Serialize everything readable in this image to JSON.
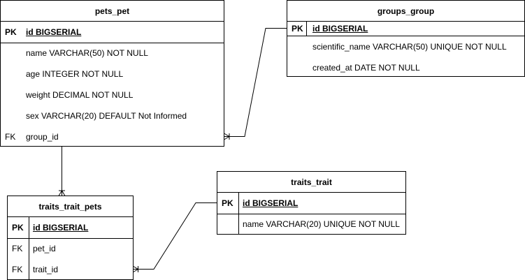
{
  "entities": {
    "pets_pet": {
      "title": "pets_pet",
      "rows": [
        {
          "key": "PK",
          "field": "id BIGSERIAL"
        },
        {
          "key": "",
          "field": "name VARCHAR(50) NOT NULL"
        },
        {
          "key": "",
          "field": "age INTEGER NOT NULL"
        },
        {
          "key": "",
          "field": "weight DECIMAL NOT NULL"
        },
        {
          "key": "",
          "field": "sex VARCHAR(20) DEFAULT Not Informed"
        },
        {
          "key": "FK",
          "field": "group_id"
        }
      ]
    },
    "groups_group": {
      "title": "groups_group",
      "rows": [
        {
          "key": "PK",
          "field": "id BIGSERIAL"
        },
        {
          "key": "",
          "field": "scientific_name VARCHAR(50) UNIQUE NOT NULL"
        },
        {
          "key": "",
          "field": "created_at DATE NOT NULL"
        }
      ]
    },
    "traits_trait_pets": {
      "title": "traits_trait_pets",
      "rows": [
        {
          "key": "PK",
          "field": "id BIGSERIAL"
        },
        {
          "key": "FK",
          "field": "pet_id"
        },
        {
          "key": "FK",
          "field": "trait_id"
        }
      ]
    },
    "traits_trait": {
      "title": "traits_trait",
      "rows": [
        {
          "key": "PK",
          "field": "id BIGSERIAL"
        },
        {
          "key": "",
          "field": "name VARCHAR(20) UNIQUE NOT NULL"
        }
      ]
    }
  },
  "relationships": [
    {
      "from": "pets_pet.group_id",
      "to": "groups_group.id",
      "cardinality": "many-to-one"
    },
    {
      "from": "traits_trait_pets.pet_id",
      "to": "pets_pet.id",
      "cardinality": "many-to-one"
    },
    {
      "from": "traits_trait_pets.trait_id",
      "to": "traits_trait.id",
      "cardinality": "many-to-one"
    }
  ]
}
